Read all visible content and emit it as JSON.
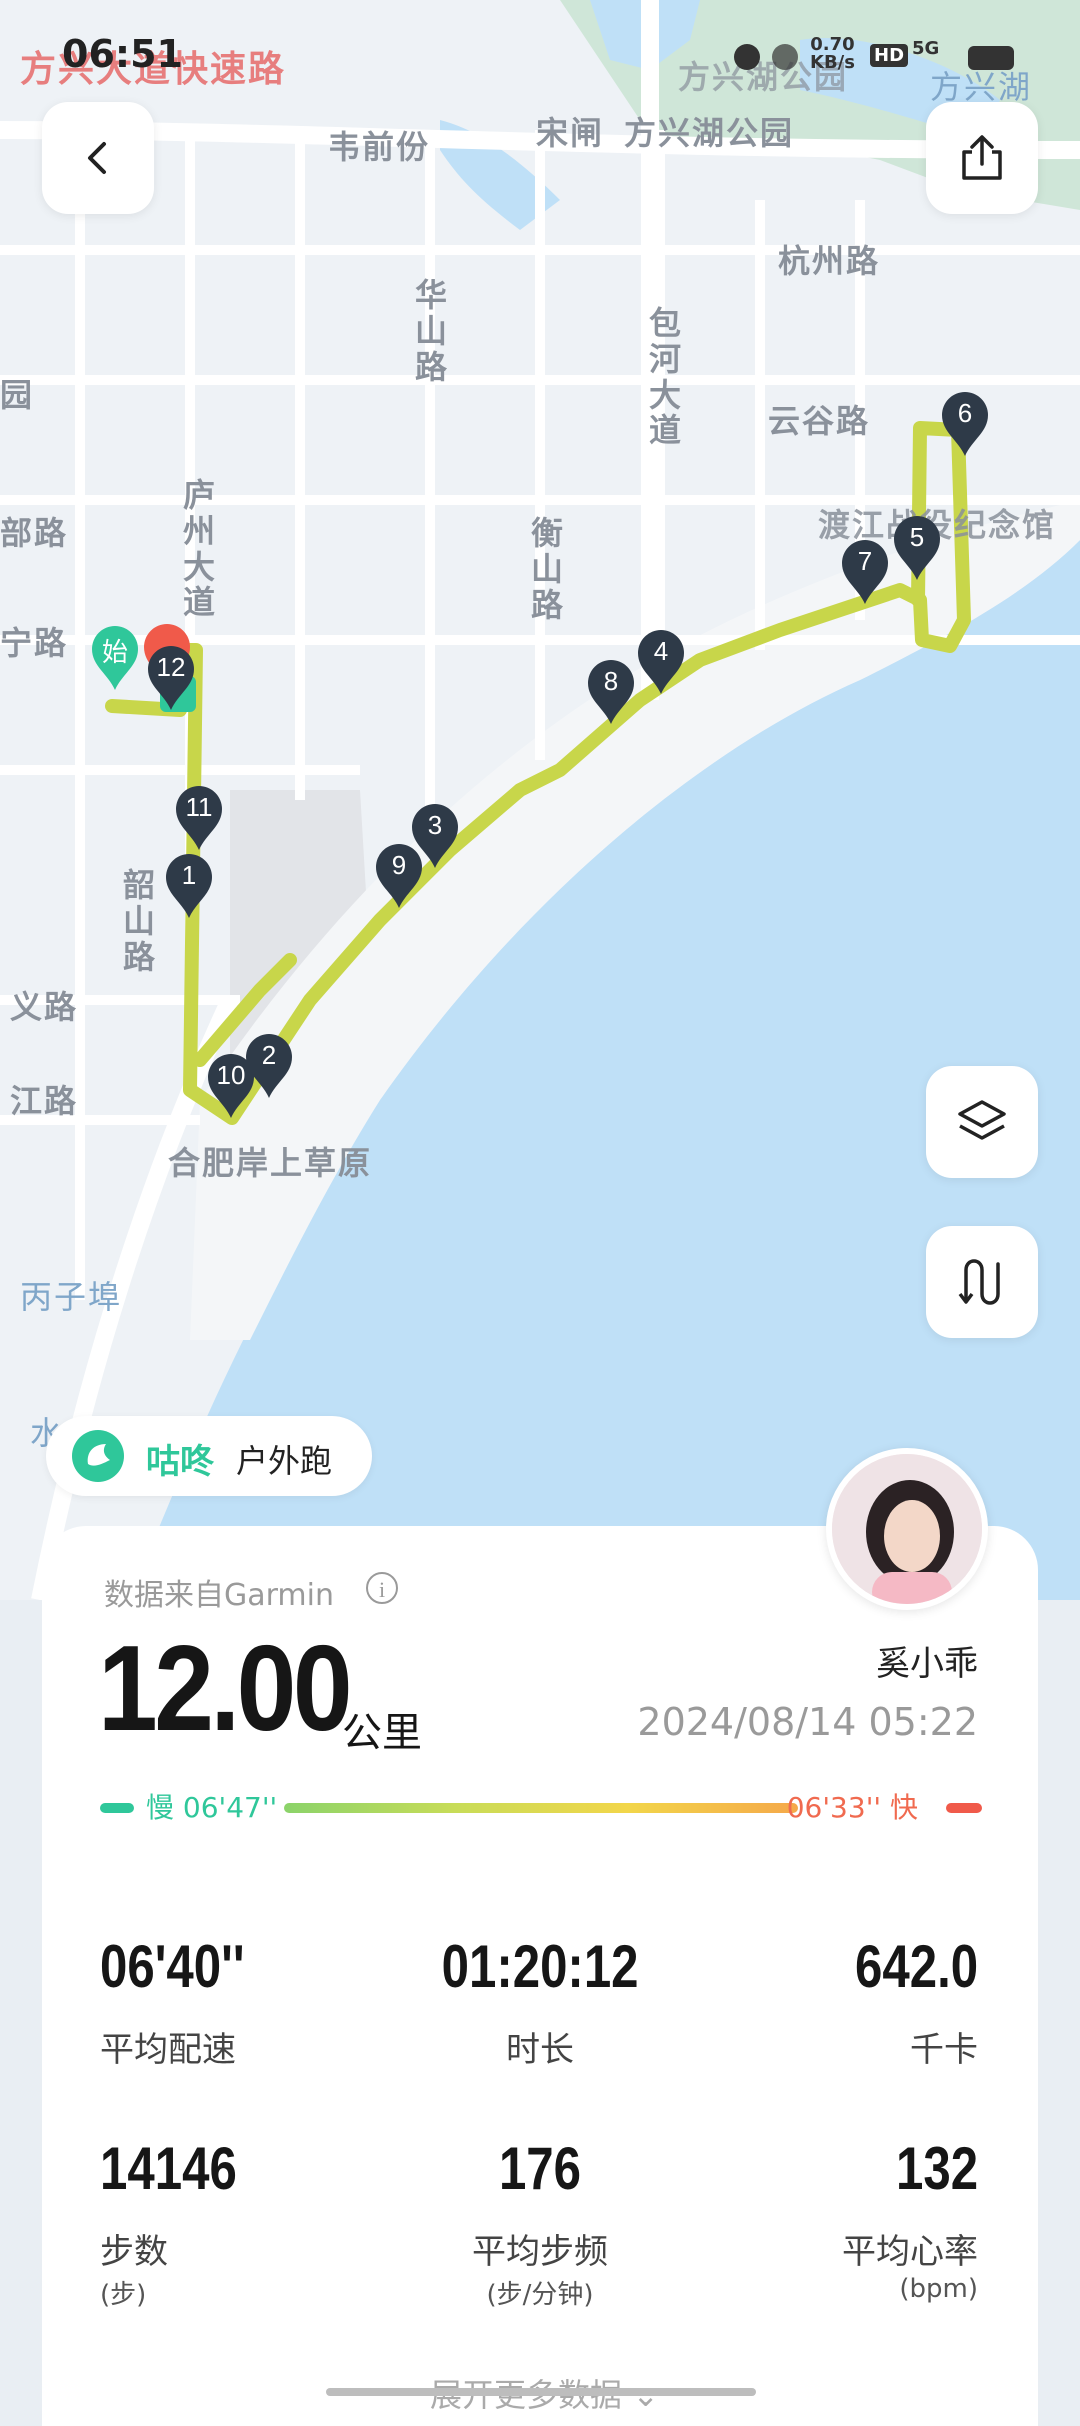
{
  "status_bar": {
    "time": "06:51",
    "overlay_text": "方兴大道快速路",
    "net_speed": "0.70",
    "net_speed_unit": "KB/s",
    "hd": "HD",
    "network": "5G"
  },
  "map": {
    "labels": {
      "weiqianfen": "韦前份",
      "songzha": "宋闸",
      "fangxinghu_park_1": "方兴湖公园",
      "fangxinghu_park_2": "方兴湖公园",
      "fangxinghu": "方兴湖",
      "hangzhou_rd": "杭州路",
      "huashan_rd": "华山路",
      "baohe_ave": "包河大道",
      "yungu_rd": "云谷路",
      "dujiang_memorial": "渡江战役纪念馆",
      "luzhou_ave": "庐州大道",
      "hengshan_rd": "衡山路",
      "shaoshan_rd": "韶山路",
      "yi_rd": "义路",
      "jiang_rd": "江路",
      "bu_rd": "部路",
      "ning_rd": "宁路",
      "yuan": "园",
      "anshang_grassland": "合肥岸上草原",
      "bingzibu": "丙子埠",
      "shui": "水"
    },
    "start_pin_label": "始",
    "km_markers": [
      "1",
      "2",
      "3",
      "4",
      "5",
      "6",
      "7",
      "8",
      "9",
      "10",
      "11",
      "12"
    ]
  },
  "workout": {
    "app_name": "咕咚",
    "activity_type": "户外跑",
    "source": "数据来自Garmin",
    "info_icon": "i",
    "distance": "12.00",
    "distance_unit": "公里",
    "user_name": "奚小乖",
    "datetime": "2024/08/14 05:22",
    "pace_slow_label": "慢 06'47''",
    "pace_fast_label": "06'33'' 快",
    "stats": [
      {
        "value": "06'40''",
        "label": "平均配速",
        "unit": ""
      },
      {
        "value": "01:20:12",
        "label": "时长",
        "unit": ""
      },
      {
        "value": "642.0",
        "label": "千卡",
        "unit": ""
      },
      {
        "value": "14146",
        "label": "步数",
        "unit": "(步)"
      },
      {
        "value": "176",
        "label": "平均步频",
        "unit": "(步/分钟)"
      },
      {
        "value": "132",
        "label": "平均心率",
        "unit": "(bpm)"
      }
    ],
    "expand_more": "展开更多数据"
  },
  "colors": {
    "route": "#c8d64a",
    "pin": "#2e3a48",
    "start_pin": "#2fc79a",
    "end_pin": "#f05a4a",
    "brand": "#2fc79a",
    "water": "#bfe0f7"
  }
}
